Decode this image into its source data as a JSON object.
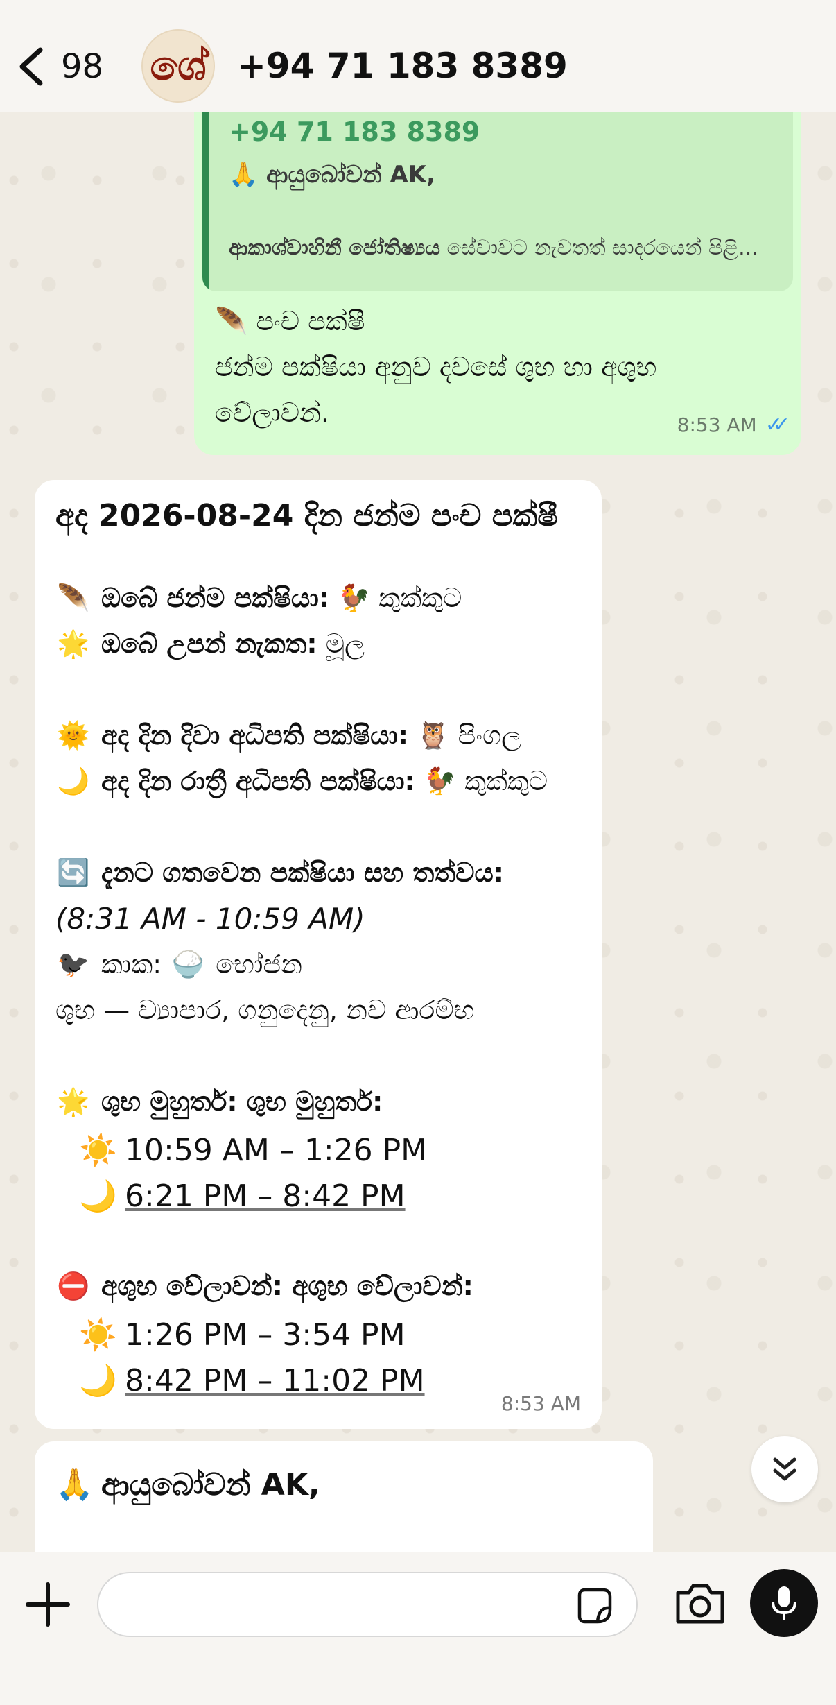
{
  "header": {
    "back_count": "98",
    "avatar_letter": "ශ්‍රී",
    "contact_name": "+94 71 183 8389"
  },
  "outgoing": {
    "quote_sender": "+94 71 183 8389",
    "quote_line1": "🙏 ආයුබෝවන් AK,",
    "quote_line2_bold": "ආකාශ්වාහිනී ජෝතිෂ්‍යය",
    "quote_line2_rest": " සේවාවට නැවතත් සාදරයෙන් පිළි...",
    "line1": "🪶 පංච පක්ෂී",
    "line2": "ජන්ම පක්ෂියා අනුව දවසේ ශුභ හා අශුභ",
    "line3": "වේලාවන්.",
    "time": "8:53 AM"
  },
  "incoming": {
    "title_prefix": "අද ",
    "title_date": "2026-08-24",
    "title_suffix": " දින ජන්ම පංච පක්ෂී",
    "birth_bird_label": "ඔබේ ජන්ම පක්ෂියා:",
    "birth_bird_value": "🐓 කුක්කුට",
    "nakshatra_label": "ඔබේ උපන් නැකත:",
    "nakshatra_value": "මූල",
    "day_ruler_label": "අද දින දිවා අධිපති පක්ෂියා:",
    "day_ruler_value": "🦉 පිංගල",
    "night_ruler_label": "අද දින රාත්‍රී අධිපති පක්ෂියා:",
    "night_ruler_value": "🐓 කුක්කුට",
    "current_label": "දැනට ගතවෙන පක්ෂියා සහ තත්වය:",
    "current_range": "(8:31 AM - 10:59 AM)",
    "current_bird": "කාක:",
    "current_state": "භෝජන",
    "current_desc": "ශුභ — ව්‍යාපාර, ගනුදෙනු, නව ආරම්භ",
    "good_label": "ශුභ මුහුර්ත: ශුභ මුහුර්ත:",
    "good_day": "10:59 AM – 1:26 PM",
    "good_night": "6:21 PM – 8:42 PM",
    "bad_label": "අශුභ වේලාවන්: අශුභ වේලාවන්:",
    "bad_day": "1:26 PM – 3:54 PM",
    "bad_night": "8:42 PM – 11:02 PM",
    "time": "8:53 AM"
  },
  "incoming2": {
    "line1": "ආයුබෝවන් AK,"
  },
  "icons": {
    "feather": "🪶",
    "star": "🌟",
    "sun_face": "🌞",
    "moon": "🌙",
    "cycle": "🔄",
    "crow": "🐦‍⬛",
    "rice": "🍚",
    "sun": "☀️",
    "no_entry": "⛔",
    "pray": "🙏"
  },
  "colors": {
    "outgoing_bg": "#d9fdd3",
    "quote_bg": "#c9efc2",
    "quote_accent": "#2f8a4f",
    "read_ticks": "#3b95ec"
  }
}
